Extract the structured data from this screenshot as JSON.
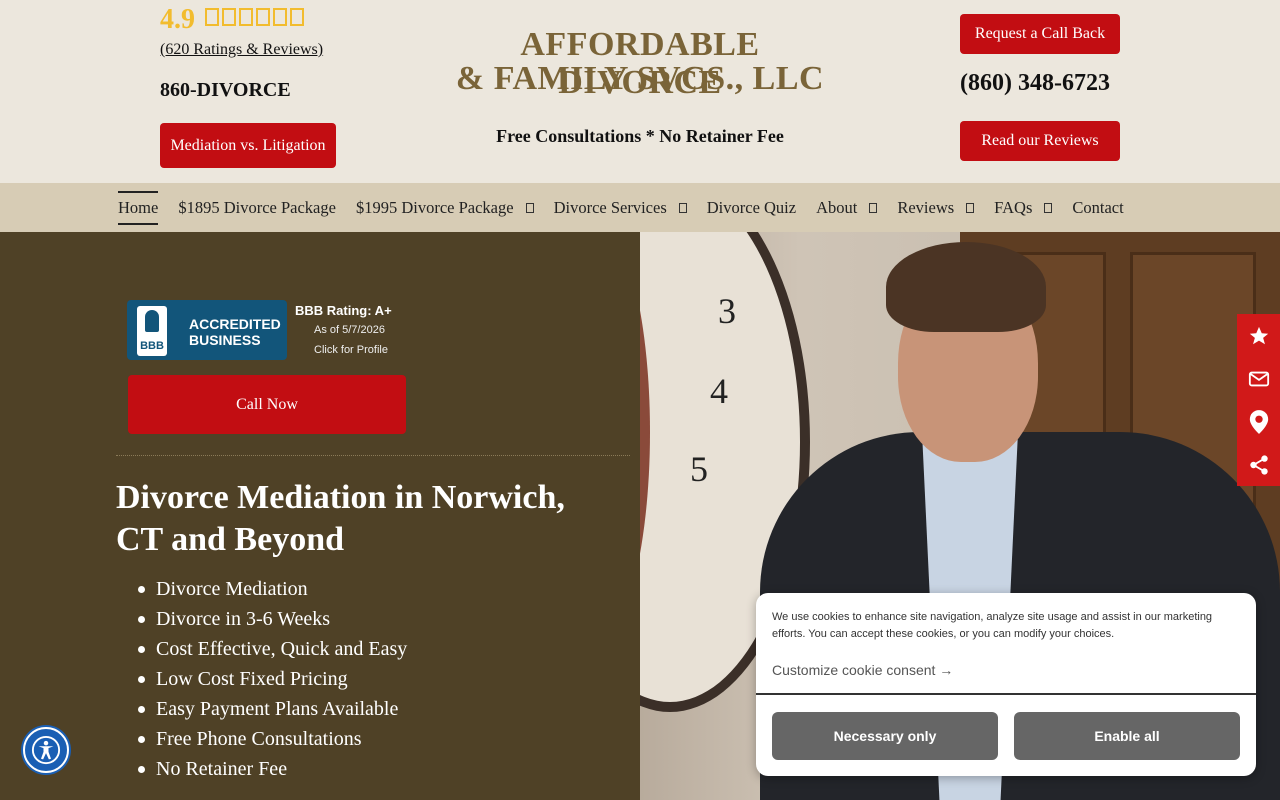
{
  "header": {
    "rating_value": "4.9",
    "ratings_link": "(620 Ratings & Reviews)",
    "short_phone": "860-DIVORCE",
    "mediation_button": "Mediation vs. Litigation",
    "logo_line1": "AFFORDABLE DIVORCE",
    "logo_line2": "& FAMILY SVCS., LLC",
    "tagline": "Free Consultations * No Retainer Fee",
    "callback_button": "Request a Call Back",
    "main_phone": "(860) 348-6723",
    "reviews_button": "Read our Reviews",
    "star_color": "#f2bc2e"
  },
  "nav": {
    "items": [
      {
        "label": "Home",
        "dropdown": false
      },
      {
        "label": "$1895 Divorce Package",
        "dropdown": false
      },
      {
        "label": "$1995 Divorce Package",
        "dropdown": true
      },
      {
        "label": "Divorce Services",
        "dropdown": true
      },
      {
        "label": "Divorce Quiz",
        "dropdown": false
      },
      {
        "label": "About",
        "dropdown": true
      },
      {
        "label": "Reviews",
        "dropdown": true
      },
      {
        "label": "FAQs",
        "dropdown": true
      },
      {
        "label": "Contact",
        "dropdown": false
      }
    ]
  },
  "hero": {
    "bbb": {
      "torch_label": "BBB",
      "accredited_line1": "ACCREDITED",
      "accredited_line2": "BUSINESS",
      "rating": "BBB Rating: A+",
      "date": "As of 5/7/2026",
      "profile": "Click for Profile"
    },
    "call_now": "Call Now",
    "title": "Divorce Mediation in Norwich, CT and Beyond",
    "bullets": [
      "Divorce Mediation",
      "Divorce in 3-6 Weeks",
      "Cost Effective, Quick and Easy",
      "Low Cost Fixed Pricing",
      "Easy Payment Plans Available",
      "Free Phone Consultations",
      "No Retainer Fee"
    ],
    "clock_numbers": [
      "3",
      "4",
      "5"
    ]
  },
  "side_toolbar": {
    "icons": [
      "star-icon",
      "mail-icon",
      "map-pin-icon",
      "share-icon"
    ],
    "color": "#d11919"
  },
  "cookie": {
    "text": "We use cookies to enhance site navigation, analyze site usage and assist in our marketing efforts. You can accept these cookies, or you can modify your choices.",
    "customize": "Customize cookie consent →",
    "necessary_only": "Necessary only",
    "enable_all": "Enable all"
  },
  "colors": {
    "brand_red": "#c20d12",
    "hero_bg": "#4f4126",
    "nav_bg": "#d7ccb5",
    "header_bg": "#ece7dd",
    "logo_color": "#7a6438"
  }
}
